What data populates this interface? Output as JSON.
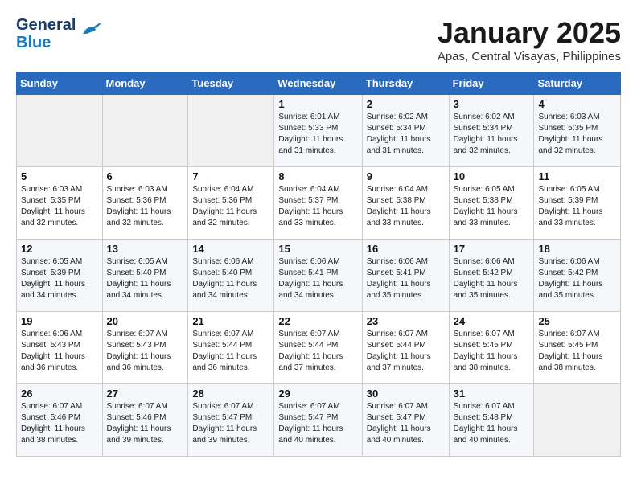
{
  "header": {
    "logo_line1": "General",
    "logo_line2": "Blue",
    "title": "January 2025",
    "subtitle": "Apas, Central Visayas, Philippines"
  },
  "days_of_week": [
    "Sunday",
    "Monday",
    "Tuesday",
    "Wednesday",
    "Thursday",
    "Friday",
    "Saturday"
  ],
  "weeks": [
    [
      {
        "day": "",
        "empty": true
      },
      {
        "day": "",
        "empty": true
      },
      {
        "day": "",
        "empty": true
      },
      {
        "day": "1",
        "sunrise": "6:01 AM",
        "sunset": "5:33 PM",
        "daylight": "11 hours and 31 minutes."
      },
      {
        "day": "2",
        "sunrise": "6:02 AM",
        "sunset": "5:34 PM",
        "daylight": "11 hours and 31 minutes."
      },
      {
        "day": "3",
        "sunrise": "6:02 AM",
        "sunset": "5:34 PM",
        "daylight": "11 hours and 32 minutes."
      },
      {
        "day": "4",
        "sunrise": "6:03 AM",
        "sunset": "5:35 PM",
        "daylight": "11 hours and 32 minutes."
      }
    ],
    [
      {
        "day": "5",
        "sunrise": "6:03 AM",
        "sunset": "5:35 PM",
        "daylight": "11 hours and 32 minutes."
      },
      {
        "day": "6",
        "sunrise": "6:03 AM",
        "sunset": "5:36 PM",
        "daylight": "11 hours and 32 minutes."
      },
      {
        "day": "7",
        "sunrise": "6:04 AM",
        "sunset": "5:36 PM",
        "daylight": "11 hours and 32 minutes."
      },
      {
        "day": "8",
        "sunrise": "6:04 AM",
        "sunset": "5:37 PM",
        "daylight": "11 hours and 33 minutes."
      },
      {
        "day": "9",
        "sunrise": "6:04 AM",
        "sunset": "5:38 PM",
        "daylight": "11 hours and 33 minutes."
      },
      {
        "day": "10",
        "sunrise": "6:05 AM",
        "sunset": "5:38 PM",
        "daylight": "11 hours and 33 minutes."
      },
      {
        "day": "11",
        "sunrise": "6:05 AM",
        "sunset": "5:39 PM",
        "daylight": "11 hours and 33 minutes."
      }
    ],
    [
      {
        "day": "12",
        "sunrise": "6:05 AM",
        "sunset": "5:39 PM",
        "daylight": "11 hours and 34 minutes."
      },
      {
        "day": "13",
        "sunrise": "6:05 AM",
        "sunset": "5:40 PM",
        "daylight": "11 hours and 34 minutes."
      },
      {
        "day": "14",
        "sunrise": "6:06 AM",
        "sunset": "5:40 PM",
        "daylight": "11 hours and 34 minutes."
      },
      {
        "day": "15",
        "sunrise": "6:06 AM",
        "sunset": "5:41 PM",
        "daylight": "11 hours and 34 minutes."
      },
      {
        "day": "16",
        "sunrise": "6:06 AM",
        "sunset": "5:41 PM",
        "daylight": "11 hours and 35 minutes."
      },
      {
        "day": "17",
        "sunrise": "6:06 AM",
        "sunset": "5:42 PM",
        "daylight": "11 hours and 35 minutes."
      },
      {
        "day": "18",
        "sunrise": "6:06 AM",
        "sunset": "5:42 PM",
        "daylight": "11 hours and 35 minutes."
      }
    ],
    [
      {
        "day": "19",
        "sunrise": "6:06 AM",
        "sunset": "5:43 PM",
        "daylight": "11 hours and 36 minutes."
      },
      {
        "day": "20",
        "sunrise": "6:07 AM",
        "sunset": "5:43 PM",
        "daylight": "11 hours and 36 minutes."
      },
      {
        "day": "21",
        "sunrise": "6:07 AM",
        "sunset": "5:44 PM",
        "daylight": "11 hours and 36 minutes."
      },
      {
        "day": "22",
        "sunrise": "6:07 AM",
        "sunset": "5:44 PM",
        "daylight": "11 hours and 37 minutes."
      },
      {
        "day": "23",
        "sunrise": "6:07 AM",
        "sunset": "5:44 PM",
        "daylight": "11 hours and 37 minutes."
      },
      {
        "day": "24",
        "sunrise": "6:07 AM",
        "sunset": "5:45 PM",
        "daylight": "11 hours and 38 minutes."
      },
      {
        "day": "25",
        "sunrise": "6:07 AM",
        "sunset": "5:45 PM",
        "daylight": "11 hours and 38 minutes."
      }
    ],
    [
      {
        "day": "26",
        "sunrise": "6:07 AM",
        "sunset": "5:46 PM",
        "daylight": "11 hours and 38 minutes."
      },
      {
        "day": "27",
        "sunrise": "6:07 AM",
        "sunset": "5:46 PM",
        "daylight": "11 hours and 39 minutes."
      },
      {
        "day": "28",
        "sunrise": "6:07 AM",
        "sunset": "5:47 PM",
        "daylight": "11 hours and 39 minutes."
      },
      {
        "day": "29",
        "sunrise": "6:07 AM",
        "sunset": "5:47 PM",
        "daylight": "11 hours and 40 minutes."
      },
      {
        "day": "30",
        "sunrise": "6:07 AM",
        "sunset": "5:47 PM",
        "daylight": "11 hours and 40 minutes."
      },
      {
        "day": "31",
        "sunrise": "6:07 AM",
        "sunset": "5:48 PM",
        "daylight": "11 hours and 40 minutes."
      },
      {
        "day": "",
        "empty": true
      }
    ]
  ],
  "labels": {
    "sunrise_prefix": "Sunrise: ",
    "sunset_prefix": "Sunset: ",
    "daylight_prefix": "Daylight: "
  }
}
